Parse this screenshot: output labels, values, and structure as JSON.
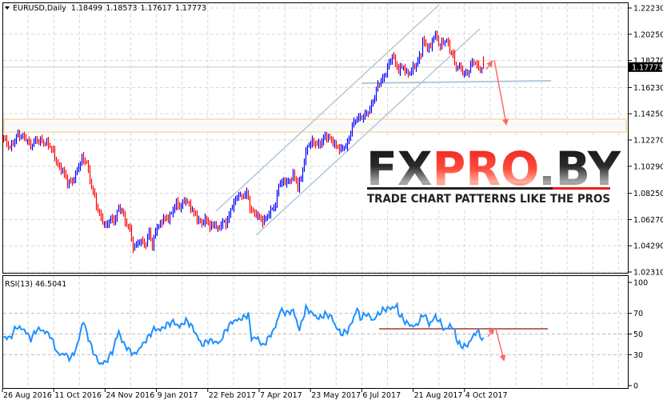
{
  "header": {
    "symbol": "EURUSD,Daily",
    "open": "1.18499",
    "high": "1.18573",
    "low": "1.17617",
    "close": "1.17773",
    "menu_icon": "triangle-down-icon"
  },
  "current_price_label": "1.17773",
  "logo": {
    "part1": "FX",
    "part2": "PRO",
    "part3": ".BY",
    "tagline": "TRADE CHART PATTERNS LIKE THE PROS"
  },
  "colors": {
    "bull_bar": "#0000ff",
    "bear_bar": "#ff0000",
    "rsi_line": "#1e90ff",
    "annotation_arrow": "#ff6666",
    "rsi_level_line": "#a33a3a",
    "channel_line": "#b4c8d8",
    "zone": "#f3d28a"
  },
  "chart_data": [
    {
      "type": "ohlc-bar",
      "title": "EURUSD,Daily",
      "x_unit": "trading day index from 26 Aug 2016",
      "ylim": [
        1.0231,
        1.2223
      ],
      "y_ticks": [
        "1.22230",
        "1.20250",
        "1.18270",
        "1.16230",
        "1.14250",
        "1.12270",
        "1.10290",
        "1.08250",
        "1.06270",
        "1.04290",
        "1.02310"
      ],
      "x_ticks": [
        "26 Aug 2016",
        "11 Oct 2016",
        "24 Nov 2016",
        "9 Jan 2017",
        "22 Feb 2017",
        "7 Apr 2017",
        "23 May 2017",
        "6 Jul 2017",
        "21 Aug 2017",
        "4 Oct 2017"
      ],
      "grid": true,
      "last_bar": {
        "open": 1.18499,
        "high": 1.18573,
        "low": 1.17617,
        "close": 1.17773
      },
      "close_path": [
        [
          0,
          1.1239
        ],
        [
          4,
          1.1167
        ],
        [
          9,
          1.1269
        ],
        [
          14,
          1.1239
        ],
        [
          17,
          1.1179
        ],
        [
          20,
          1.1227
        ],
        [
          24,
          1.1215
        ],
        [
          28,
          1.1197
        ],
        [
          31,
          1.1137
        ],
        [
          34,
          1.1028
        ],
        [
          37,
          1.0998
        ],
        [
          40,
          1.0907
        ],
        [
          43,
          1.0913
        ],
        [
          46,
          1.0998
        ],
        [
          49,
          1.1088
        ],
        [
          52,
          1.1058
        ],
        [
          54,
          1.0925
        ],
        [
          56,
          1.0835
        ],
        [
          59,
          1.0696
        ],
        [
          62,
          1.0611
        ],
        [
          64,
          1.0575
        ],
        [
          67,
          1.0636
        ],
        [
          69,
          1.0611
        ],
        [
          72,
          1.0714
        ],
        [
          74,
          1.0696
        ],
        [
          76,
          1.0611
        ],
        [
          79,
          1.0551
        ],
        [
          81,
          1.0412
        ],
        [
          84,
          1.0455
        ],
        [
          87,
          1.0461
        ],
        [
          89,
          1.043
        ],
        [
          91,
          1.0551
        ],
        [
          93,
          1.0412
        ],
        [
          95,
          1.0551
        ],
        [
          98,
          1.0593
        ],
        [
          100,
          1.0636
        ],
        [
          103,
          1.0636
        ],
        [
          105,
          1.0672
        ],
        [
          108,
          1.0756
        ],
        [
          110,
          1.0714
        ],
        [
          113,
          1.0774
        ],
        [
          115,
          1.0756
        ],
        [
          118,
          1.0696
        ],
        [
          121,
          1.0636
        ],
        [
          124,
          1.0593
        ],
        [
          126,
          1.0636
        ],
        [
          129,
          1.0575
        ],
        [
          132,
          1.0593
        ],
        [
          134,
          1.0551
        ],
        [
          137,
          1.0611
        ],
        [
          139,
          1.0593
        ],
        [
          142,
          1.0696
        ],
        [
          144,
          1.0756
        ],
        [
          147,
          1.0817
        ],
        [
          149,
          1.0793
        ],
        [
          152,
          1.0835
        ],
        [
          154,
          1.0714
        ],
        [
          157,
          1.0672
        ],
        [
          159,
          1.0654
        ],
        [
          162,
          1.0611
        ],
        [
          165,
          1.0654
        ],
        [
          168,
          1.0714
        ],
        [
          170,
          1.0732
        ],
        [
          172,
          1.0895
        ],
        [
          175,
          1.0913
        ],
        [
          179,
          1.0913
        ],
        [
          181,
          1.0974
        ],
        [
          184,
          1.0877
        ],
        [
          186,
          1.0937
        ],
        [
          188,
          1.1076
        ],
        [
          190,
          1.1179
        ],
        [
          193,
          1.1215
        ],
        [
          195,
          1.1197
        ],
        [
          198,
          1.1197
        ],
        [
          201,
          1.1257
        ],
        [
          204,
          1.1239
        ],
        [
          208,
          1.1179
        ],
        [
          211,
          1.1155
        ],
        [
          215,
          1.1197
        ],
        [
          218,
          1.1336
        ],
        [
          221,
          1.1396
        ],
        [
          224,
          1.1396
        ],
        [
          228,
          1.1438
        ],
        [
          230,
          1.1487
        ],
        [
          232,
          1.1559
        ],
        [
          234,
          1.1638
        ],
        [
          236,
          1.168
        ],
        [
          238,
          1.1698
        ],
        [
          240,
          1.1782
        ],
        [
          242,
          1.1819
        ],
        [
          243,
          1.1879
        ],
        [
          245,
          1.18
        ],
        [
          247,
          1.1758
        ],
        [
          250,
          1.1782
        ],
        [
          252,
          1.1722
        ],
        [
          254,
          1.174
        ],
        [
          257,
          1.1782
        ],
        [
          258,
          1.18
        ],
        [
          261,
          1.1879
        ],
        [
          262,
          1.1982
        ],
        [
          264,
          1.1939
        ],
        [
          267,
          1.1921
        ],
        [
          269,
          1.2024
        ],
        [
          271,
          1.2
        ],
        [
          272,
          1.1939
        ],
        [
          275,
          1.1963
        ],
        [
          277,
          1.1982
        ],
        [
          279,
          1.1903
        ],
        [
          281,
          1.1879
        ],
        [
          282,
          1.1782
        ],
        [
          285,
          1.1782
        ],
        [
          287,
          1.174
        ],
        [
          290,
          1.1722
        ],
        [
          292,
          1.18
        ],
        [
          295,
          1.1819
        ],
        [
          297,
          1.1758
        ],
        [
          300,
          1.17773
        ]
      ]
    },
    {
      "type": "line",
      "title": "RSI(13) 46.5041",
      "name": "RSI(13)",
      "current_value": "46.5041",
      "ylim": [
        0,
        100
      ],
      "y_ticks": [
        "100",
        "70",
        "50",
        "30",
        "0"
      ],
      "levels": [
        70,
        50,
        30
      ],
      "points": [
        [
          0,
          47
        ],
        [
          4,
          46
        ],
        [
          8,
          57
        ],
        [
          13,
          54
        ],
        [
          17,
          45
        ],
        [
          21,
          55
        ],
        [
          25,
          53
        ],
        [
          29,
          49
        ],
        [
          32,
          38
        ],
        [
          34,
          30
        ],
        [
          38,
          31
        ],
        [
          42,
          26
        ],
        [
          46,
          38
        ],
        [
          49,
          59
        ],
        [
          50,
          62
        ],
        [
          53,
          46
        ],
        [
          56,
          33
        ],
        [
          60,
          21
        ],
        [
          64,
          23
        ],
        [
          68,
          33
        ],
        [
          72,
          53
        ],
        [
          74,
          43
        ],
        [
          78,
          35
        ],
        [
          82,
          30
        ],
        [
          86,
          38
        ],
        [
          90,
          46
        ],
        [
          94,
          55
        ],
        [
          98,
          54
        ],
        [
          102,
          59
        ],
        [
          106,
          62
        ],
        [
          110,
          57
        ],
        [
          114,
          63
        ],
        [
          117,
          59
        ],
        [
          120,
          51
        ],
        [
          124,
          39
        ],
        [
          128,
          44
        ],
        [
          131,
          43
        ],
        [
          135,
          41
        ],
        [
          139,
          54
        ],
        [
          143,
          62
        ],
        [
          149,
          65
        ],
        [
          153,
          69
        ],
        [
          155,
          46
        ],
        [
          159,
          46
        ],
        [
          162,
          38
        ],
        [
          166,
          47
        ],
        [
          170,
          57
        ],
        [
          173,
          73
        ],
        [
          177,
          70
        ],
        [
          181,
          73
        ],
        [
          185,
          54
        ],
        [
          189,
          75
        ],
        [
          193,
          70
        ],
        [
          197,
          65
        ],
        [
          201,
          69
        ],
        [
          205,
          67
        ],
        [
          207,
          59
        ],
        [
          211,
          50
        ],
        [
          215,
          53
        ],
        [
          218,
          62
        ],
        [
          221,
          75
        ],
        [
          223,
          65
        ],
        [
          227,
          70
        ],
        [
          231,
          63
        ],
        [
          234,
          69
        ],
        [
          238,
          74
        ],
        [
          242,
          75
        ],
        [
          246,
          77
        ],
        [
          247,
          70
        ],
        [
          251,
          62
        ],
        [
          255,
          58
        ],
        [
          258,
          58
        ],
        [
          260,
          63
        ],
        [
          263,
          70
        ],
        [
          266,
          59
        ],
        [
          270,
          67
        ],
        [
          274,
          59
        ],
        [
          276,
          53
        ],
        [
          279,
          59
        ],
        [
          282,
          53
        ],
        [
          284,
          41
        ],
        [
          287,
          38
        ],
        [
          290,
          39
        ],
        [
          294,
          49
        ],
        [
          296,
          53
        ],
        [
          299,
          46
        ],
        [
          300,
          46.5
        ]
      ]
    }
  ]
}
